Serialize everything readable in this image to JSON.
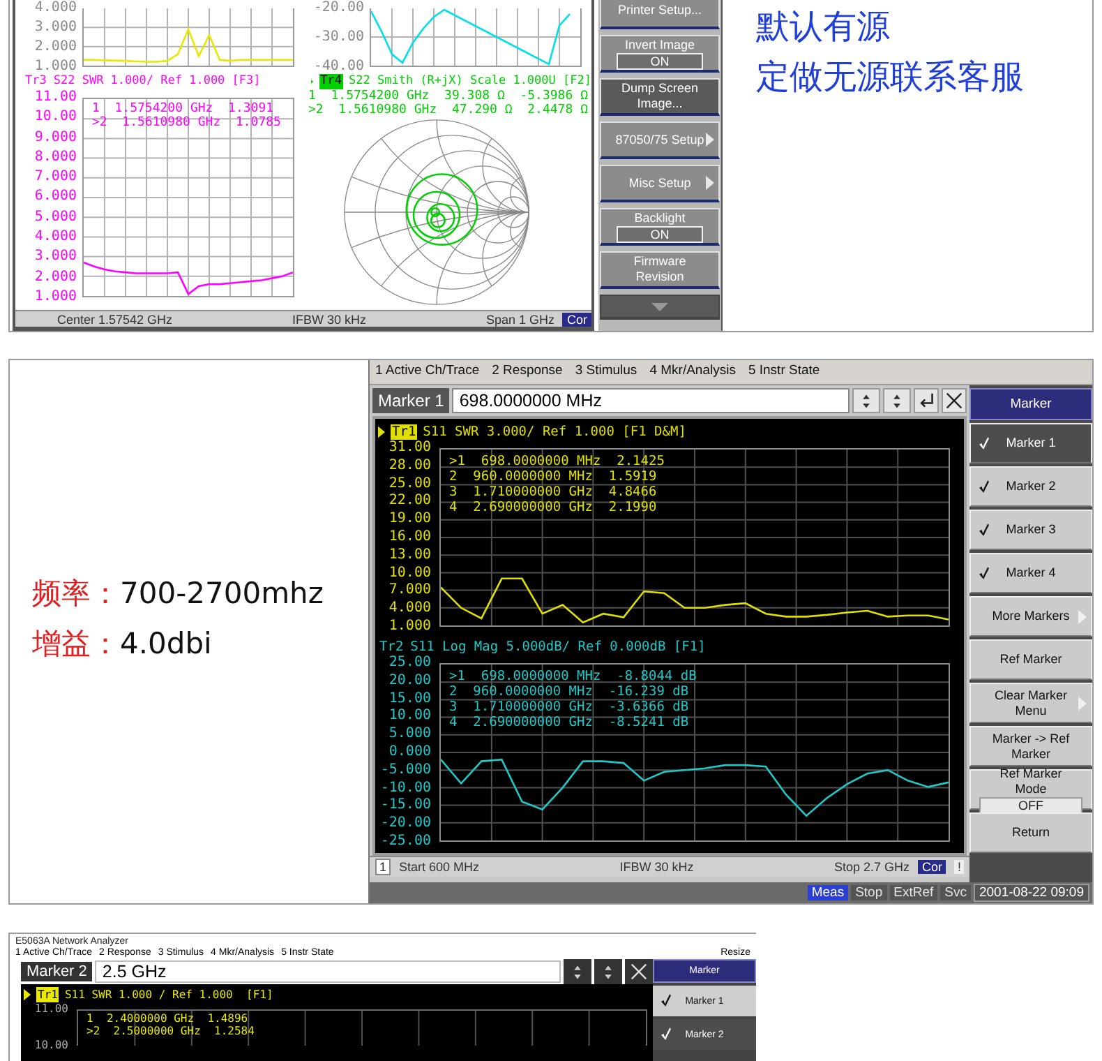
{
  "top_panel": {
    "upper_charts": [
      {
        "chart_data": {
          "type": "line",
          "ylim": [
            1,
            4
          ],
          "yticks": [
            {
              "value": 4,
              "label": "4.000"
            },
            {
              "value": 3,
              "label": "3.000"
            },
            {
              "value": 2,
              "label": "2.000"
            },
            {
              "value": 1,
              "label": "1.000"
            }
          ],
          "series": [
            {
              "color": "#e8e800",
              "values": [
                1.3,
                1.3,
                1.28,
                1.26,
                1.25,
                1.22,
                1.2,
                1.2,
                1.25,
                1.6,
                2.9,
                1.5,
                2.6,
                1.3,
                1.25,
                1.3,
                1.3,
                1.3,
                1.3,
                1.3,
                1.3
              ]
            }
          ],
          "grid": true
        }
      },
      {
        "chart_data": {
          "type": "line",
          "ylim": [
            -40,
            -20
          ],
          "yticks": [
            {
              "value": -20,
              "label": "-20.00"
            },
            {
              "value": -30,
              "label": "-30.00"
            },
            {
              "value": -40,
              "label": "-40.00"
            }
          ],
          "series": [
            {
              "color": "#00e0e8",
              "values": [
                -21,
                -28,
                -36,
                -39,
                -32,
                -27,
                -23,
                -20.5,
                null,
                null,
                null,
                null,
                null,
                null,
                null,
                null,
                null,
                -39.5,
                -26,
                -22,
                null
              ]
            }
          ],
          "grid": true
        }
      }
    ],
    "swr_trace": {
      "tag": "Tr3",
      "active": false,
      "title": "S22 SWR 1.000/ Ref 1.000 [F3]",
      "color": "#ff00ff",
      "chart_data": {
        "type": "line",
        "ylim": [
          1,
          11
        ],
        "yticks": [
          {
            "value": 11,
            "label": "11.00"
          },
          {
            "value": 10,
            "label": "10.00"
          },
          {
            "value": 9,
            "label": "9.000"
          },
          {
            "value": 8,
            "label": "8.000"
          },
          {
            "value": 7,
            "label": "7.000"
          },
          {
            "value": 6,
            "label": "6.000"
          },
          {
            "value": 5,
            "label": "5.000"
          },
          {
            "value": 4,
            "label": "4.000"
          },
          {
            "value": 3,
            "label": "3.000"
          },
          {
            "value": 2,
            "label": "2.000"
          },
          {
            "value": 1,
            "label": "1.000"
          }
        ],
        "series": [
          {
            "color": "#ff00ff",
            "values": [
              2.7,
              2.5,
              2.35,
              2.25,
              2.2,
              2.15,
              2.15,
              2.15,
              2.15,
              2.2,
              1.1,
              1.5,
              1.6,
              1.6,
              1.65,
              1.7,
              1.75,
              1.8,
              1.9,
              2.0,
              2.2
            ]
          }
        ],
        "grid": true
      },
      "readouts": [
        "1  1.5754200 GHz  1.3091",
        ">2  1.5610980 GHz  1.0785"
      ]
    },
    "smith_trace": {
      "tag": "Tr4",
      "active": true,
      "title": "S22 Smith (R+jX) Scale 1.000U [F2]",
      "color": "#00d000",
      "readouts": [
        "1  1.5754200 GHz  39.308 Ω  -5.3986 Ω",
        ">2  1.5610980 GHz  47.290 Ω  2.4478 Ω"
      ]
    },
    "status_bar": {
      "items": [
        "Center 1.57542 GHz",
        "IFBW 30 kHz",
        "Span 1 GHz"
      ],
      "correction": "Cor"
    },
    "softkeys": [
      {
        "kind": "plain",
        "label": "Printer Setup...",
        "selected": false
      },
      {
        "kind": "toggle",
        "label": "Invert Image",
        "value": "ON",
        "selected": false
      },
      {
        "kind": "plain",
        "label": "Dump Screen Image...",
        "selected": true
      },
      {
        "kind": "submenu",
        "label": "87050/75 Setup",
        "selected": false
      },
      {
        "kind": "submenu",
        "label": "Misc Setup",
        "selected": false
      },
      {
        "kind": "toggle",
        "label": "Backlight",
        "value": "ON",
        "selected": false
      },
      {
        "kind": "plain",
        "label": "Firmware Revision",
        "selected": false
      }
    ],
    "notes": [
      "默认有源",
      "定做无源联系客服"
    ]
  },
  "spec_panel": {
    "specs": [
      {
        "label": "频率：",
        "value": "700-2700mhz"
      },
      {
        "label": "增益：",
        "value": "4.0dbi"
      }
    ],
    "analyzer": {
      "menu": [
        "1 Active Ch/Trace",
        "2 Response",
        "3 Stimulus",
        "4 Mkr/Analysis",
        "5 Instr State"
      ],
      "entry": {
        "label": "Marker 1",
        "value": "698.0000000 MHz"
      },
      "traces": [
        {
          "tag": "Tr1",
          "active": true,
          "title": "S11 SWR 3.000/ Ref 1.000 [F1 D&M]",
          "color": "#e0e000",
          "chart_data": {
            "type": "line",
            "ylim": [
              1,
              31
            ],
            "yticks": [
              {
                "value": 31,
                "label": "31.00"
              },
              {
                "value": 28,
                "label": "28.00"
              },
              {
                "value": 25,
                "label": "25.00"
              },
              {
                "value": 22,
                "label": "22.00"
              },
              {
                "value": 19,
                "label": "19.00"
              },
              {
                "value": 16,
                "label": "16.00"
              },
              {
                "value": 13,
                "label": "13.00"
              },
              {
                "value": 10,
                "label": "10.00"
              },
              {
                "value": 7,
                "label": "7.000"
              },
              {
                "value": 4,
                "label": "4.000"
              },
              {
                "value": 1,
                "label": "1.000"
              }
            ],
            "series": [
              {
                "color": "#e0e000",
                "values": [
                  7.5,
                  4,
                  2.2,
                  9,
                  9,
                  3,
                  4.5,
                  1.5,
                  3,
                  2.4,
                  6.8,
                  6.5,
                  4,
                  4,
                  4.5,
                  4.8,
                  3,
                  2.5,
                  2.5,
                  2.8,
                  3.2,
                  3.5,
                  2.5,
                  2.7,
                  2.7,
                  2.0
                ]
              }
            ],
            "grid": true
          },
          "readouts": [
            ">1  698.0000000 MHz  2.1425",
            "2  960.0000000 MHz  1.5919",
            "3  1.710000000 GHz  4.8466",
            "4  2.690000000 GHz  2.1990"
          ]
        },
        {
          "tag": "Tr2",
          "active": false,
          "title": "S11 Log Mag 5.000dB/ Ref 0.000dB [F1]",
          "color": "#20c8c8",
          "chart_data": {
            "type": "line",
            "ylim": [
              -25,
              25
            ],
            "yticks": [
              {
                "value": 25,
                "label": "25.00"
              },
              {
                "value": 20,
                "label": "20.00"
              },
              {
                "value": 15,
                "label": "15.00"
              },
              {
                "value": 10,
                "label": "10.00"
              },
              {
                "value": 5,
                "label": "5.000"
              },
              {
                "value": 0,
                "label": "0.000"
              },
              {
                "value": -5,
                "label": "-5.000"
              },
              {
                "value": -10,
                "label": "-10.00"
              },
              {
                "value": -15,
                "label": "-15.00"
              },
              {
                "value": -20,
                "label": "-20.00"
              },
              {
                "value": -25,
                "label": "-25.00"
              }
            ],
            "series": [
              {
                "color": "#20c8c8",
                "values": [
                  -2,
                  -8.8,
                  -2.5,
                  -2,
                  -14,
                  -16.2,
                  -10,
                  -2.5,
                  -2.5,
                  -3,
                  -8,
                  -5.5,
                  -5,
                  -4.5,
                  -3.6,
                  -3.6,
                  -4,
                  -12,
                  -18,
                  -13,
                  -9,
                  -6,
                  -5,
                  -8,
                  -9.8,
                  -8.5
                ]
              }
            ],
            "grid": true
          },
          "readouts": [
            ">1  698.0000000 MHz  -8.8044 dB",
            "2  960.0000000 MHz  -16.239 dB",
            "3  1.710000000 GHz  -3.6366 dB",
            "4  2.690000000 GHz  -8.5241 dB"
          ]
        }
      ],
      "status_bar": {
        "channel": "1",
        "items": [
          "Start 600 MHz",
          "IFBW 30 kHz",
          "Stop 2.7 GHz"
        ],
        "correction": "Cor",
        "flag": "!"
      },
      "indicators": [
        {
          "label": "Meas",
          "on": true
        },
        {
          "label": "Stop",
          "on": false
        },
        {
          "label": "ExtRef",
          "on": false
        },
        {
          "label": "Svc",
          "on": false
        }
      ],
      "clock": "2001-08-22 09:09",
      "softkey_title": "Marker",
      "softkeys": [
        {
          "kind": "plain",
          "label": "Marker 1",
          "checked": true,
          "selected": true
        },
        {
          "kind": "plain",
          "label": "Marker 2",
          "checked": true,
          "selected": false
        },
        {
          "kind": "plain",
          "label": "Marker 3",
          "checked": true,
          "selected": false
        },
        {
          "kind": "plain",
          "label": "Marker 4",
          "checked": true,
          "selected": false
        },
        {
          "kind": "submenu",
          "label": "More Markers",
          "checked": false,
          "selected": false
        },
        {
          "kind": "plain",
          "label": "Ref Marker",
          "checked": false,
          "selected": false
        },
        {
          "kind": "submenu",
          "label": "Clear Marker Menu",
          "checked": false,
          "selected": false
        },
        {
          "kind": "plain",
          "label": "Marker -> Ref Marker",
          "checked": false,
          "selected": false
        },
        {
          "kind": "toggle",
          "label": "Ref Marker Mode",
          "value": "OFF",
          "checked": false,
          "selected": false
        },
        {
          "kind": "plain",
          "label": "Return",
          "checked": false,
          "selected": false
        }
      ]
    }
  },
  "bottom_panel": {
    "title": "E5063A Network Analyzer",
    "menu": [
      "1 Active Ch/Trace",
      "2 Response",
      "3 Stimulus",
      "4 Mkr/Analysis",
      "5 Instr State"
    ],
    "resize": "Resize",
    "entry": {
      "label": "Marker 2",
      "value": "2.5 GHz"
    },
    "trace": {
      "tag": "Tr1",
      "active": true,
      "title": "S11 SWR 1.000 / Ref 1.000  [F1]",
      "color": "#e8e800",
      "y_labels": [
        "11.00",
        "10.00"
      ],
      "readouts": [
        "1  2.4000000 GHz  1.4896",
        ">2  2.5000000 GHz  1.2584"
      ]
    },
    "softkey_title": "Marker",
    "softkeys": [
      {
        "kind": "plain",
        "label": "Marker 1",
        "checked": true,
        "selected": false
      },
      {
        "kind": "plain",
        "label": "Marker 2",
        "checked": true,
        "selected": true
      }
    ]
  }
}
